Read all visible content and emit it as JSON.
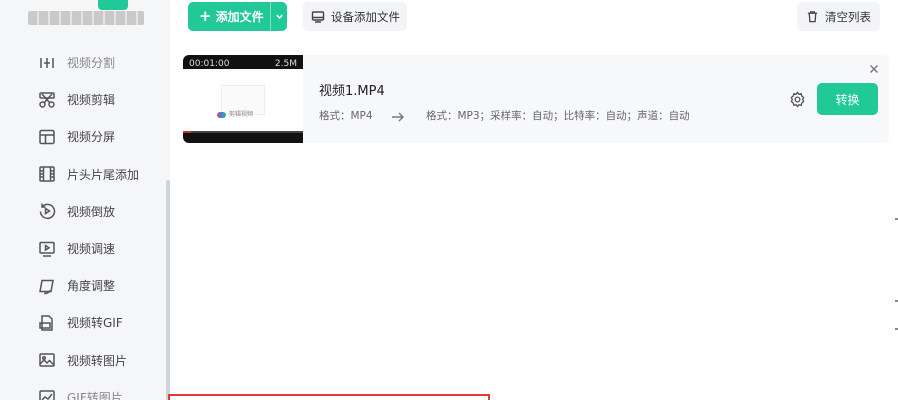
{
  "app": {
    "brand_text": "▓▓▓▓▓▓▓▓"
  },
  "sidebar": {
    "items": [
      {
        "label": "视频分割",
        "icon": "split-icon"
      },
      {
        "label": "视频剪辑",
        "icon": "scissors-icon"
      },
      {
        "label": "视频分屏",
        "icon": "split-screen-icon"
      },
      {
        "label": "片头片尾添加",
        "icon": "film-strip-icon"
      },
      {
        "label": "视频倒放",
        "icon": "rewind-icon"
      },
      {
        "label": "视频调速",
        "icon": "speed-monitor-icon"
      },
      {
        "label": "角度调整",
        "icon": "rotate-icon"
      },
      {
        "label": "视频转GIF",
        "icon": "gif-icon"
      },
      {
        "label": "视频转图片",
        "icon": "image-icon"
      },
      {
        "label": "GIF转图片",
        "icon": "chart-image-icon"
      }
    ]
  },
  "toolbar": {
    "add_file_label": "添加文件",
    "device_add_label": "设备添加文件",
    "clear_list_label": "清空列表"
  },
  "files": [
    {
      "name": "视频1.MP4",
      "duration": "00:01:00",
      "size": "2.5M",
      "thumb_logo_text": "剪辑视频",
      "source_format": "格式：MP4",
      "target_format": "格式：MP3；采样率：自动；比特率：自动；声道：自动",
      "convert_label": "转换"
    }
  ],
  "colors": {
    "accent": "#20c997",
    "sidebar_bg": "#f5f6f8",
    "card_bg": "#f7f8fa",
    "selection": "#e53935"
  }
}
